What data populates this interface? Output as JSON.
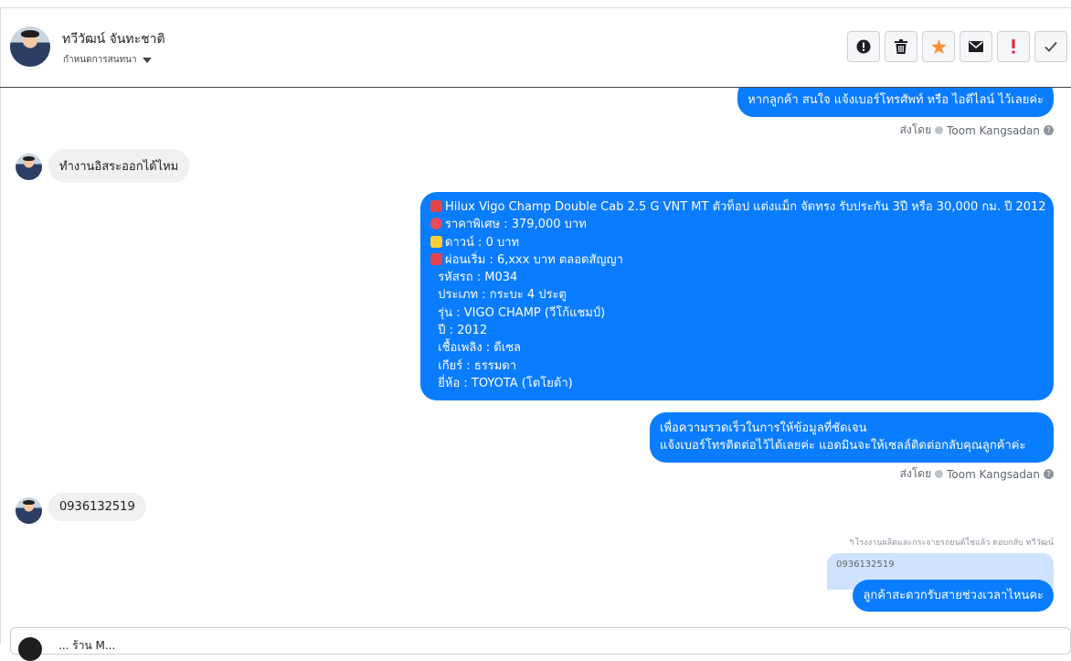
{
  "header": {
    "contact_name": "ทวีวัฒน์ จันทะชาติ",
    "sub_label": "กำหนดการสนทนา",
    "toolbar": {
      "icons": [
        "exclamation-circle-icon",
        "trash-icon",
        "star-icon",
        "envelope-icon",
        "exclamation-icon",
        "check-icon"
      ]
    }
  },
  "messages": {
    "top_partial": "หากลูกค้า สนใจ แจ้งเบอร์โทรศัพท์ หรือ ไอดีไลน์  ไว้เลยค่ะ",
    "sent_by_1": {
      "prefix": "ส่งโดย",
      "agent": "Toom Kangsadan"
    },
    "incoming_1": "ทำงานอิสระออกได้ไหม",
    "car_listing": {
      "lines": [
        "Hilux Vigo Champ Double Cab 2.5 G VNT MT ตัวท็อป แต่งแม็ก จัดทรง รับประกัน 3ปี หรือ 30,000 กม. ปี 2012",
        "ราคาพิเศษ : 379,000 บาท",
        "ดาวน์ : 0 บาท",
        "ผ่อนเริ่ม : 6,xxx บาท ตลอดสัญญา",
        "  รหัสรถ : M034",
        "  ประเภท : กระบะ 4 ประตู",
        "  รุ่น : VIGO CHAMP (วีโก้แชมป์)",
        "  ปี : 2012",
        "  เชื้อเพลิง : ดีเซล",
        "  เกียร์ : ธรรมดา",
        "  ยี่ห้อ : TOYOTA (โตโยต้า)"
      ],
      "emoji": [
        "car-icon",
        "pin-icon",
        "star-emoji-icon",
        "car-icon"
      ]
    },
    "outgoing_2": {
      "line1": "เพื่อความรวดเร็วในการให้ข้อมูลที่ชัดเจน",
      "line2": "แจ้งเบอร์โทรติดต่อไว้ได้เลยค่ะ แอดมินจะให้เซลล์ติดต่อกลับคุณลูกค้าค่ะ"
    },
    "sent_by_2": {
      "prefix": "ส่งโดย",
      "agent": "Toom Kangsadan"
    },
    "incoming_2": "0936132519",
    "reply_note": "โรงงานผลิตและกระจายรถยนต์ใช่แล้ว ตอบกลับ ทวีวัฒน์",
    "reply_quote": "0936132519",
    "outgoing_3": "ลูกค้าสะดวกรับสายช่วงเวลาไหนคะ"
  },
  "composer": {
    "text": "... ร้าน M..."
  },
  "colors": {
    "outgoing_bubble": "#0a7cff",
    "incoming_bubble": "#f0f0f0",
    "quote_bg": "#cfe3ff"
  }
}
